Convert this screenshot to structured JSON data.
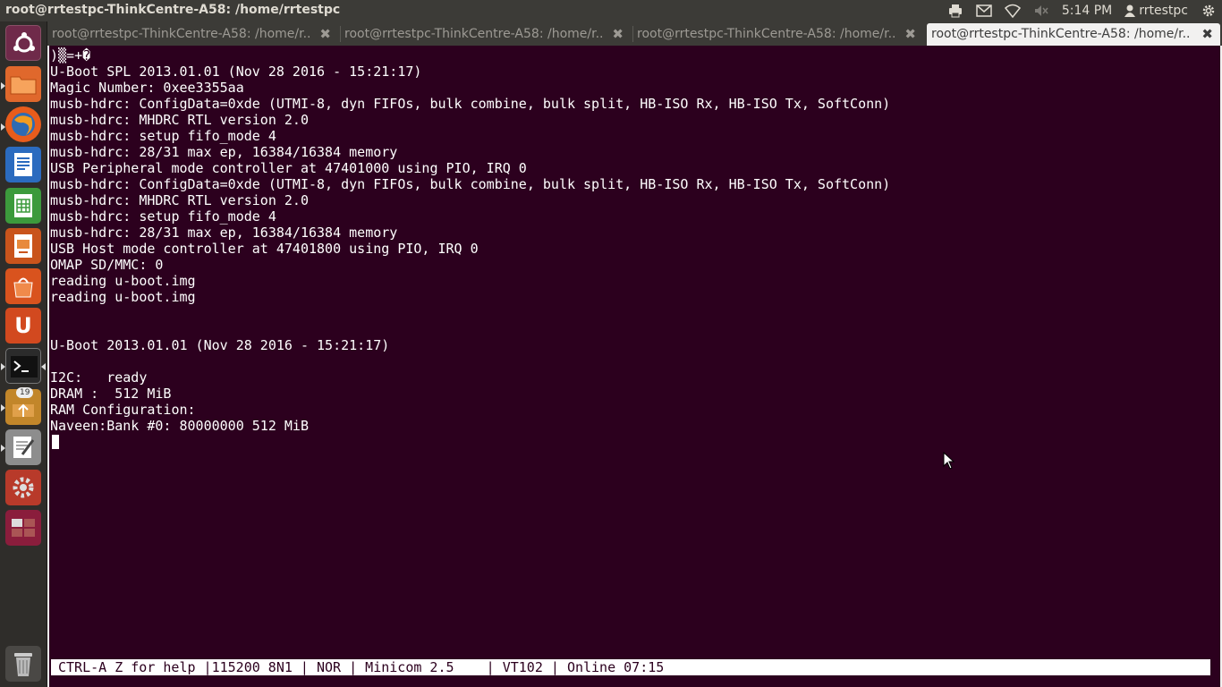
{
  "window": {
    "title": "root@rrtestpc-ThinkCentre-A58: /home/rrtestpc"
  },
  "top_panel": {
    "indicators": [
      "printer-icon",
      "mail-icon",
      "wifi-icon",
      "volume-muted-icon",
      "user-icon",
      "gear-icon"
    ],
    "clock": "5:14 PM",
    "username": "rrtestpc"
  },
  "launcher": {
    "items": [
      "dash-home-icon",
      "files-icon",
      "firefox-icon",
      "writer-icon",
      "calc-icon",
      "impress-icon",
      "software-center-icon",
      "ubuntu-one-icon",
      "terminal-icon",
      "update-manager-icon",
      "text-editor-icon",
      "system-settings-icon",
      "workspace-switcher-icon",
      "trash-icon"
    ],
    "update_badge": "19"
  },
  "tabs": [
    {
      "label": "root@rrtestpc-ThinkCentre-A58: /home/r...",
      "active": false
    },
    {
      "label": "root@rrtestpc-ThinkCentre-A58: /home/r...",
      "active": false
    },
    {
      "label": "root@rrtestpc-ThinkCentre-A58: /home/r...",
      "active": false
    },
    {
      "label": "root@rrtestpc-ThinkCentre-A58: /home/r...",
      "active": true
    }
  ],
  "terminal": {
    "lines": [
      ")▒=+�",
      "U-Boot SPL 2013.01.01 (Nov 28 2016 - 15:21:17)",
      "Magic Number: 0xee3355aa",
      "musb-hdrc: ConfigData=0xde (UTMI-8, dyn FIFOs, bulk combine, bulk split, HB-ISO Rx, HB-ISO Tx, SoftConn)",
      "musb-hdrc: MHDRC RTL version 2.0",
      "musb-hdrc: setup fifo_mode 4",
      "musb-hdrc: 28/31 max ep, 16384/16384 memory",
      "USB Peripheral mode controller at 47401000 using PIO, IRQ 0",
      "musb-hdrc: ConfigData=0xde (UTMI-8, dyn FIFOs, bulk combine, bulk split, HB-ISO Rx, HB-ISO Tx, SoftConn)",
      "musb-hdrc: MHDRC RTL version 2.0",
      "musb-hdrc: setup fifo_mode 4",
      "musb-hdrc: 28/31 max ep, 16384/16384 memory",
      "USB Host mode controller at 47401800 using PIO, IRQ 0",
      "OMAP SD/MMC: 0",
      "reading u-boot.img",
      "reading u-boot.img",
      "",
      "",
      "U-Boot 2013.01.01 (Nov 28 2016 - 15:21:17)",
      "",
      "I2C:   ready",
      "DRAM :  512 MiB",
      "RAM Configuration:",
      "Naveen:Bank #0: 80000000 512 MiB"
    ],
    "status_line": "CTRL-A Z for help |115200 8N1 | NOR | Minicom 2.5    | VT102 | Online 07:15"
  }
}
